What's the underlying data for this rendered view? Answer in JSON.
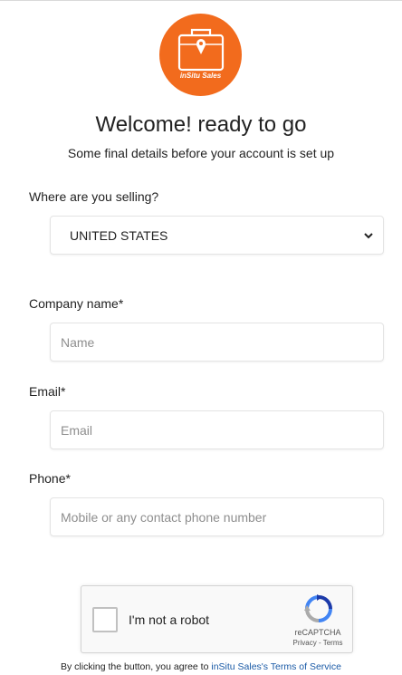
{
  "brand": {
    "logo_text": "inSitu Sales",
    "accent_color": "#f26b1d"
  },
  "header": {
    "title": "Welcome! ready to go",
    "subtitle": "Some final details before your account is set up"
  },
  "form": {
    "country": {
      "label": "Where are you selling?",
      "value": "UNITED STATES"
    },
    "company": {
      "label": "Company name*",
      "placeholder": "Name",
      "value": ""
    },
    "email": {
      "label": "Email*",
      "placeholder": "Email",
      "value": ""
    },
    "phone": {
      "label": "Phone*",
      "placeholder": "Mobile or any contact phone number",
      "value": ""
    }
  },
  "captcha": {
    "label": "I'm not a robot",
    "brand": "reCAPTCHA",
    "links": "Privacy - Terms",
    "icon": "recaptcha-icon"
  },
  "footer": {
    "terms_prefix": "By clicking the button, you agree to ",
    "terms_link": "inSitu Sales's Terms of Service"
  }
}
